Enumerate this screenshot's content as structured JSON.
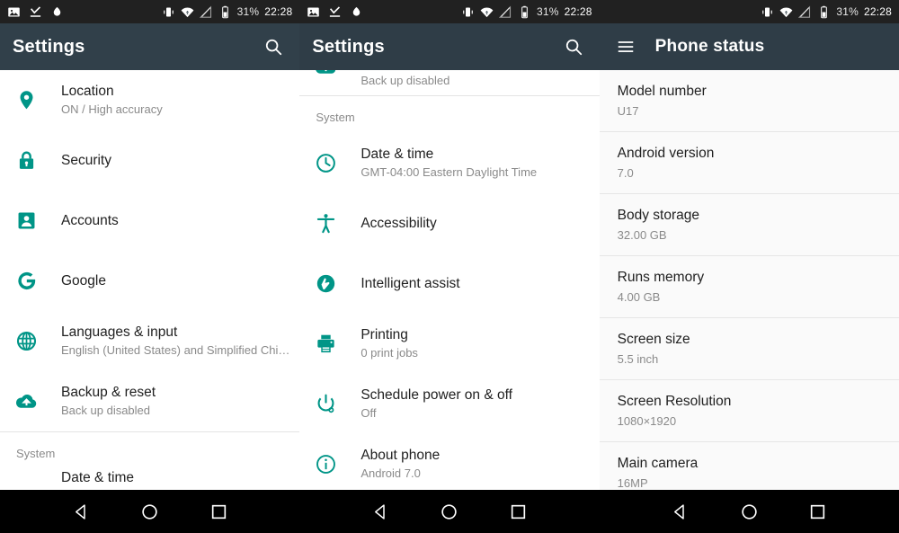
{
  "statusbar": {
    "icons_left": [
      "image-icon",
      "check-download-icon",
      "droplet-icon"
    ],
    "icons_right": [
      "vibrate-icon",
      "wifi-icon",
      "signal-off-icon",
      "battery-icon"
    ],
    "battery_percent": "31%",
    "time": "22:28"
  },
  "accent_color": "#009587",
  "toolbar_color": "#31404a",
  "panel_left": {
    "title": "Settings",
    "search_icon": "search-icon",
    "items": [
      {
        "icon": "location-pin-icon",
        "title": "Location",
        "sub": "ON / High accuracy"
      },
      {
        "icon": "lock-icon",
        "title": "Security",
        "sub": ""
      },
      {
        "icon": "account-icon",
        "title": "Accounts",
        "sub": ""
      },
      {
        "icon": "google-g-icon",
        "title": "Google",
        "sub": ""
      },
      {
        "icon": "globe-icon",
        "title": "Languages & input",
        "sub": "English (United States) and Simplified Chi…"
      },
      {
        "icon": "cloud-upload-icon",
        "title": "Backup & reset",
        "sub": "Back up disabled"
      }
    ],
    "section_header": "System",
    "cutoff_item": "Date & time"
  },
  "panel_mid": {
    "title": "Settings",
    "search_icon": "search-icon",
    "top_partial": {
      "icon": "cloud-upload-icon",
      "sub": "Back up disabled"
    },
    "section_header": "System",
    "items": [
      {
        "icon": "clock-icon",
        "title": "Date & time",
        "sub": "GMT-04:00 Eastern Daylight Time"
      },
      {
        "icon": "accessibility-icon",
        "title": "Accessibility",
        "sub": ""
      },
      {
        "icon": "intelligent-assist-icon",
        "title": "Intelligent assist",
        "sub": ""
      },
      {
        "icon": "printer-icon",
        "title": "Printing",
        "sub": "0 print jobs"
      },
      {
        "icon": "power-schedule-icon",
        "title": "Schedule power on & off",
        "sub": "Off"
      },
      {
        "icon": "info-icon",
        "title": "About phone",
        "sub": "Android 7.0"
      }
    ]
  },
  "panel_right": {
    "title": "Phone status",
    "menu_icon": "hamburger-icon",
    "rows": [
      {
        "key": "Model number",
        "value": "U17"
      },
      {
        "key": "Android version",
        "value": "7.0"
      },
      {
        "key": "Body storage",
        "value": "32.00 GB"
      },
      {
        "key": "Runs memory",
        "value": "4.00 GB"
      },
      {
        "key": "Screen size",
        "value": "5.5 inch"
      },
      {
        "key": "Screen Resolution",
        "value": "1080×1920"
      },
      {
        "key": "Main camera",
        "value": "16MP"
      }
    ]
  },
  "navbar": {
    "back": "back-triangle-icon",
    "home": "home-circle-icon",
    "recents": "recents-square-icon"
  }
}
